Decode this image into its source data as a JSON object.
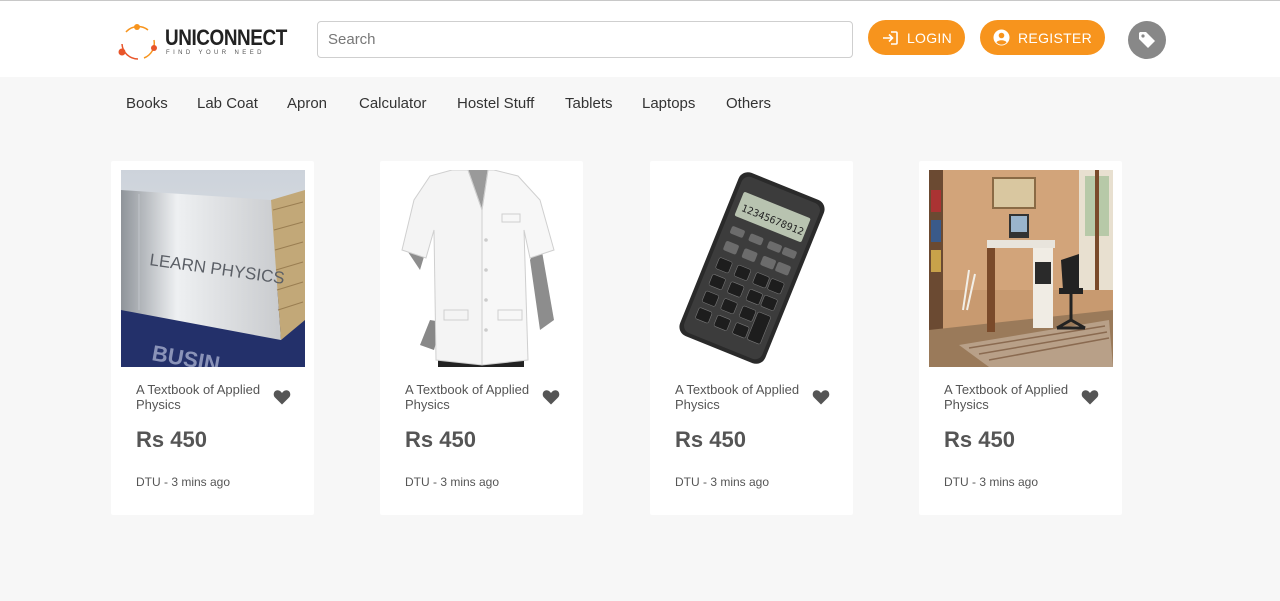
{
  "brand": {
    "name": "UNICONNECT",
    "tagline": "FIND YOUR NEED",
    "accent": "#f7941d"
  },
  "search": {
    "placeholder": "Search",
    "value": ""
  },
  "header": {
    "login_label": "LOGIN",
    "register_label": "REGISTER",
    "login_icon": "sign-in-icon",
    "register_icon": "user-circle-icon",
    "tag_icon": "tag-icon"
  },
  "nav": {
    "items": [
      {
        "label": "Books"
      },
      {
        "label": "Lab Coat"
      },
      {
        "label": "Apron"
      },
      {
        "label": "Calculator"
      },
      {
        "label": "Hostel Stuff"
      },
      {
        "label": "Tablets"
      },
      {
        "label": "Laptops"
      },
      {
        "label": "Others"
      }
    ]
  },
  "products": [
    {
      "title": "A Textbook of Applied Physics",
      "price": "Rs 450",
      "meta": "DTU - 3 mins ago",
      "image_text": "LEARN PHYSICS",
      "image_text_2": "BUSIN",
      "image": "physics-book"
    },
    {
      "title": "A Textbook of Applied Physics",
      "price": "Rs 450",
      "meta": "DTU - 3 mins ago",
      "image": "lab-coat"
    },
    {
      "title": "A Textbook of Applied Physics",
      "price": "Rs 450",
      "meta": "DTU - 3 mins ago",
      "image_text": "12345678912",
      "image": "calculator"
    },
    {
      "title": "A Textbook of Applied Physics",
      "price": "Rs 450",
      "meta": "DTU - 3 mins ago",
      "image": "study-desk"
    }
  ]
}
